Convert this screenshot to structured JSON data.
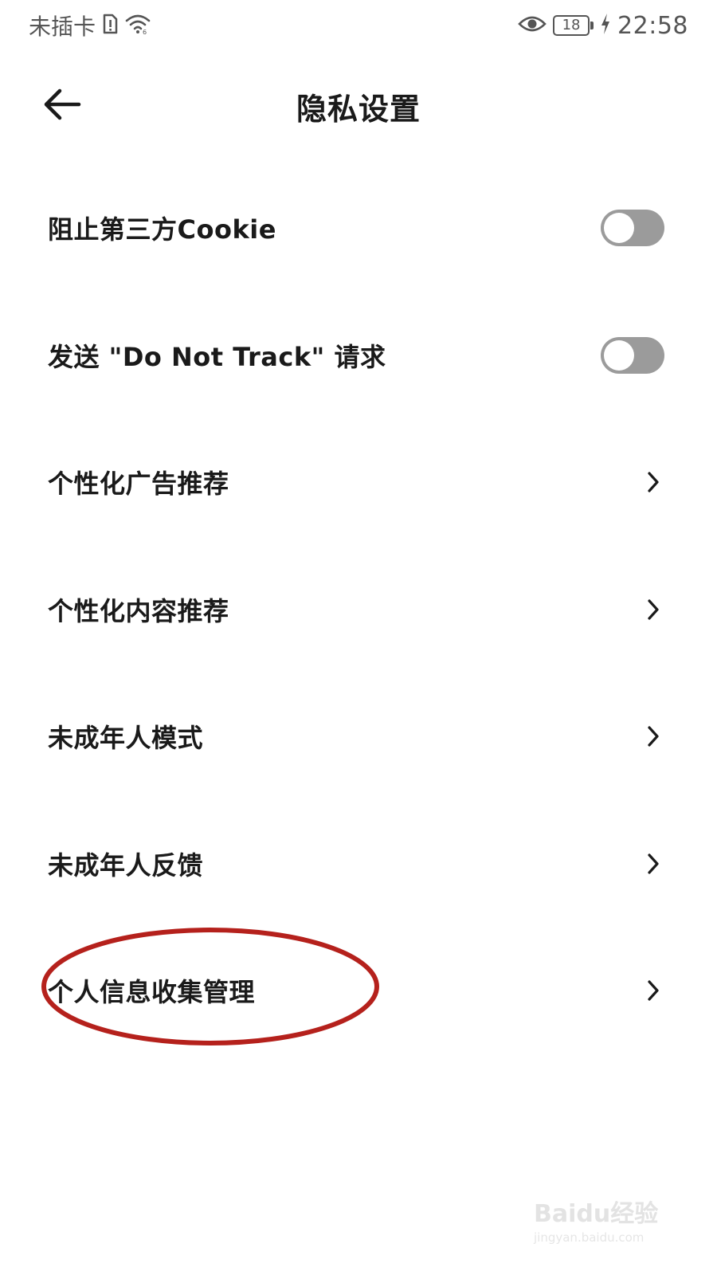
{
  "status_bar": {
    "carrier": "未插卡",
    "battery": "18",
    "time": "22:58"
  },
  "header": {
    "title": "隐私设置"
  },
  "settings": [
    {
      "label": "阻止第三方Cookie",
      "control": "toggle",
      "on": false
    },
    {
      "label": "发送 \"Do Not Track\" 请求",
      "control": "toggle",
      "on": false
    },
    {
      "label": "个性化广告推荐",
      "control": "chevron"
    },
    {
      "label": "个性化内容推荐",
      "control": "chevron"
    },
    {
      "label": "未成年人模式",
      "control": "chevron"
    },
    {
      "label": "未成年人反馈",
      "control": "chevron"
    },
    {
      "label": "个人信息收集管理",
      "control": "chevron",
      "highlighted": true
    }
  ],
  "watermark": {
    "brand": "Baidu经验",
    "url": "jingyan.baidu.com"
  },
  "colors": {
    "annotation": "#b5211c",
    "toggle_off": "#9b9b9b"
  }
}
